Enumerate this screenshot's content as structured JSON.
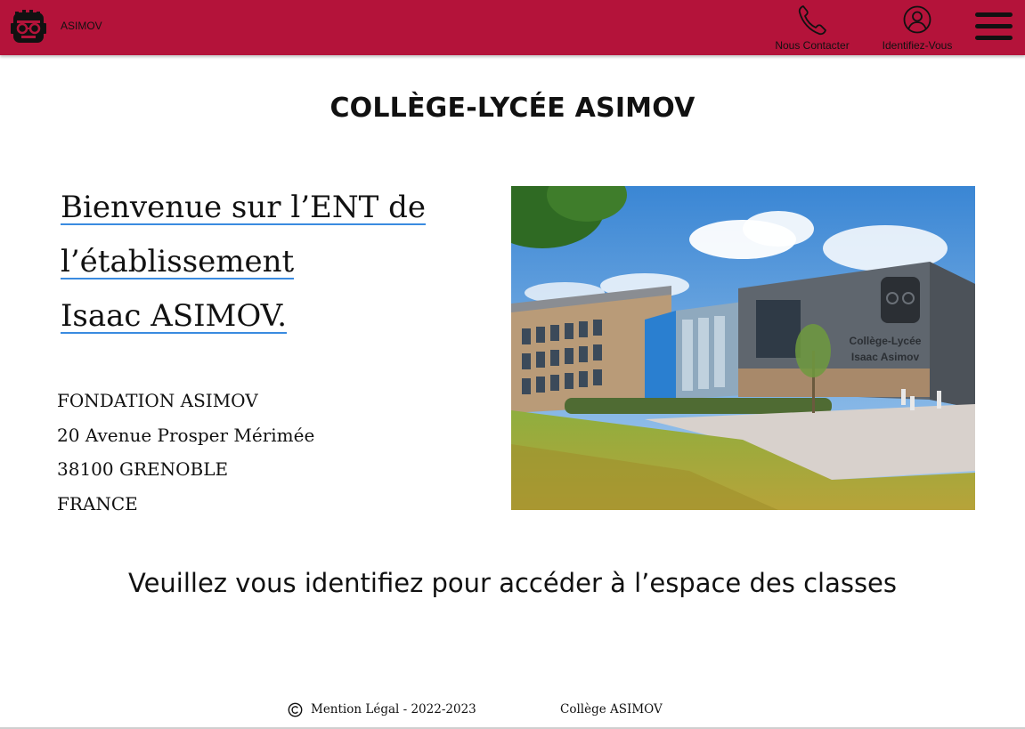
{
  "header": {
    "brand": "ASIMOV",
    "contact_label": "Nous Contacter",
    "login_label": "Identifiez-Vous",
    "background_color": "#b4133a",
    "icons": [
      "robot-logo-icon",
      "phone-icon",
      "user-circle-icon",
      "hamburger-menu-icon"
    ]
  },
  "main": {
    "title": "COLLÈGE-LYCÉE ASIMOV",
    "welcome": {
      "line1": "Bienvenue sur l’ENT de",
      "line2": "l’établissement ",
      "line3": "Isaac ASIMOV."
    },
    "address": {
      "line1": "FONDATION ASIMOV",
      "line2": "20 Avenue Prosper Mérimée",
      "line3": "38100 GRENOBLE",
      "line4": "FRANCE"
    },
    "photo": {
      "sign_line1": "Collège-Lycée",
      "sign_line2": "Isaac Asimov"
    },
    "cta": "Veuillez vous identifiez pour accéder à l’espace des classes"
  },
  "footer": {
    "legal": "Mention Légal - 2022-2023",
    "school": "Collège ASIMOV"
  }
}
